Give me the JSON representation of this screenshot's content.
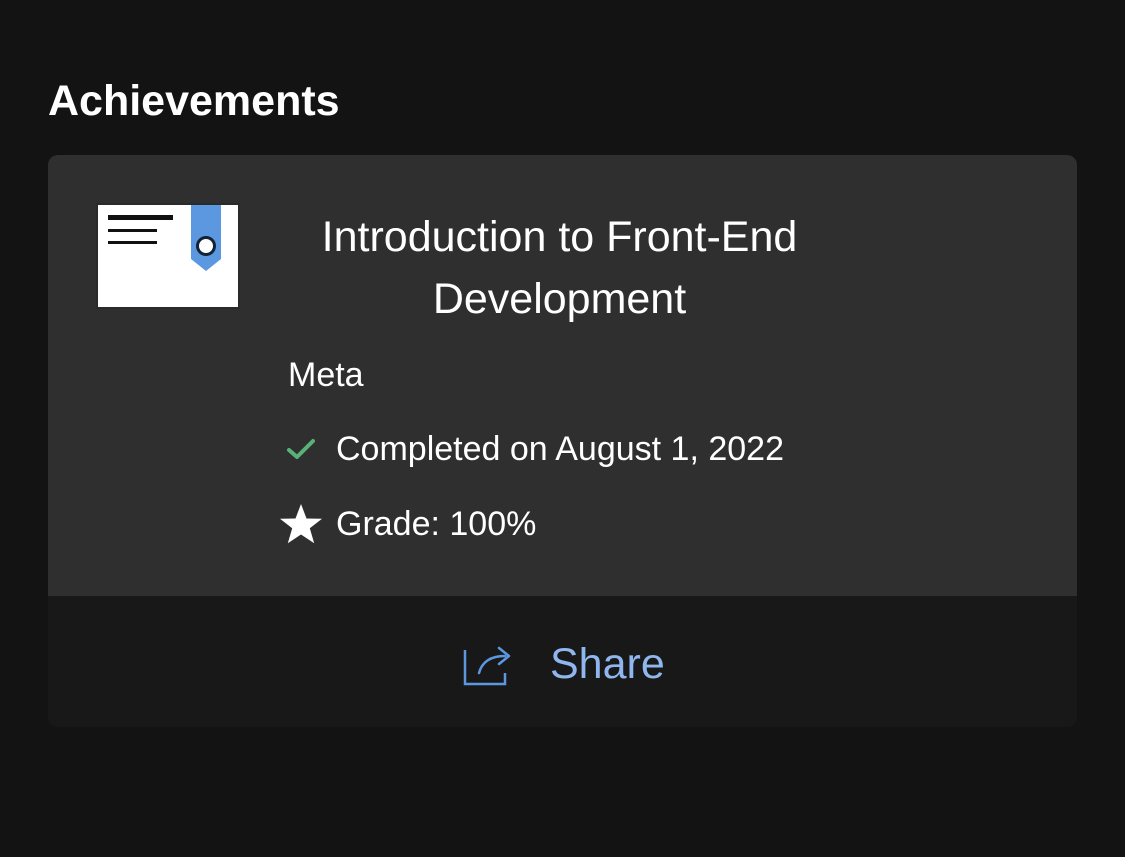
{
  "section": {
    "title": "Achievements"
  },
  "achievement": {
    "title": "Introduction to Front-End Development",
    "provider": "Meta",
    "completed_text": "Completed on August 1, 2022",
    "grade_text": "Grade: 100%",
    "share_label": "Share"
  },
  "icons": {
    "certificate": "certificate-icon",
    "check": "check-icon",
    "star": "star-icon",
    "share": "share-icon"
  },
  "colors": {
    "background": "#131313",
    "card": "#2f2f2f",
    "footer": "#181818",
    "text": "#ffffff",
    "accent": "#8fb6ee",
    "check": "#59b177",
    "certificate_ribbon": "#5b98df"
  }
}
